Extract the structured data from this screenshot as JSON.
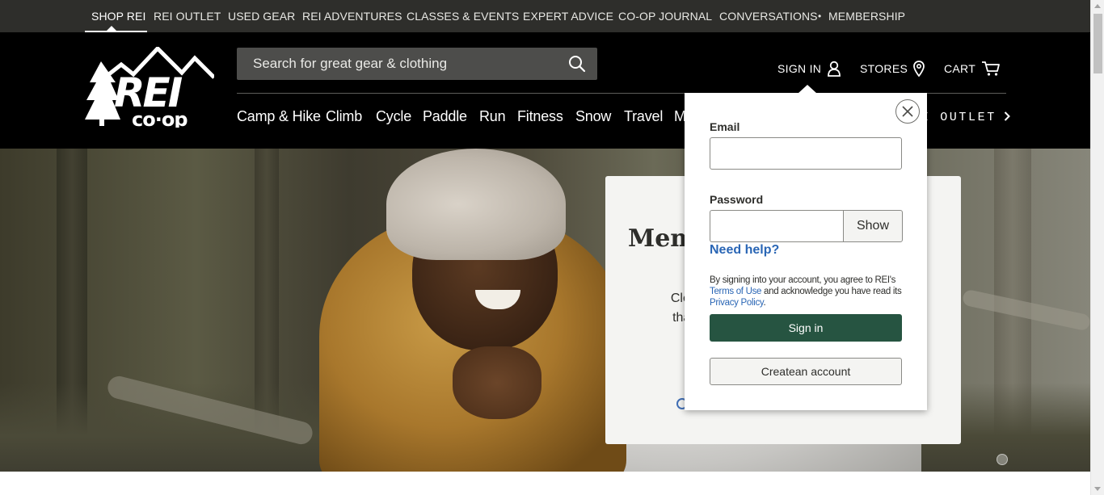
{
  "topbar": {
    "links": [
      {
        "label": "SHOP REI",
        "active": true
      },
      {
        "label": "REI OUTLET"
      },
      {
        "label": "USED GEAR"
      },
      {
        "label": "REI ADVENTURES"
      },
      {
        "label": "CLASSES & EVENTS"
      },
      {
        "label": "EXPERT ADVICE"
      },
      {
        "label": "CO-OP JOURNAL"
      },
      {
        "label": "CONVERSATIONS"
      },
      {
        "label": "MEMBERSHIP"
      }
    ],
    "separator": "•"
  },
  "header": {
    "logo_alt": "REI Co-op",
    "search_placeholder": "Search for great gear & clothing",
    "sign_in": "SIGN IN",
    "stores": "STORES",
    "cart": "CART",
    "categories": [
      "Camp & Hike",
      "Climb",
      "Cycle",
      "Paddle",
      "Run",
      "Fitness",
      "Snow",
      "Travel",
      "M"
    ],
    "outlet_link": "I OUTLET"
  },
  "hero": {
    "card_title": "Mem                             r",
    "card_body_line1": "Clear out                                            on",
    "card_body_line2": "that new                                              n"
  },
  "signin_popover": {
    "email_label": "Email",
    "email_value": "",
    "password_label": "Password",
    "password_value": "",
    "show_label": "Show",
    "help_label": "Need help?",
    "legal_prefix": "By signing into your account, you agree to REI's",
    "terms_label": "Terms of Use",
    "legal_middle": "and acknowledge you have read its",
    "privacy_label": "Privacy Policy",
    "legal_suffix": ".",
    "signin_label": "Sign in",
    "create_label": "Createan account"
  },
  "colors": {
    "topbar_bg": "#2e2e2b",
    "header_bg": "#000000",
    "signin_button": "#265441",
    "link_blue": "#2a66b5"
  }
}
